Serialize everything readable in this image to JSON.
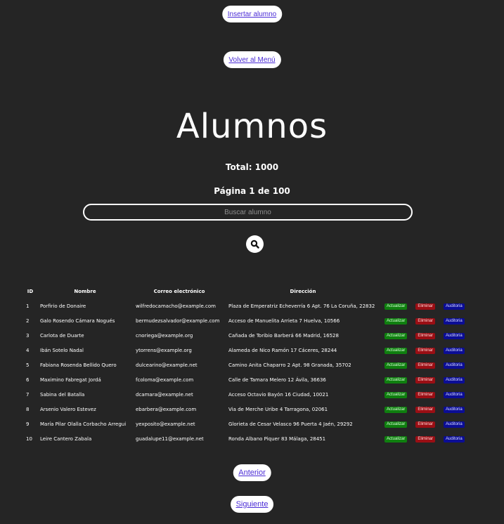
{
  "nav": {
    "insert_label": "Insertar alumno",
    "menu_label": "Volver al Menú"
  },
  "header": {
    "title": "Alumnos",
    "total": "Total: 1000",
    "page": "Página 1 de 100"
  },
  "search": {
    "placeholder": "Buscar alumno",
    "icon": "search-icon"
  },
  "table": {
    "headers": [
      "ID",
      "Nombre",
      "Correo electrónico",
      "Dirección"
    ],
    "actions": {
      "update": "Actualizar",
      "delete": "Eliminar",
      "audit": "Auditoria"
    },
    "rows": [
      {
        "id": "1",
        "nombre": "Porfirio de Donaire",
        "correo": "wilfredocamacho@example.com",
        "direccion": "Plaza de Emperatriz Echeverría 6 Apt. 76 La Coruña, 22832"
      },
      {
        "id": "2",
        "nombre": "Galo Rosendo Cámara Nogués",
        "correo": "bermudezsalvador@example.com",
        "direccion": "Acceso de Manuelita Arrieta 7 Huelva, 10566"
      },
      {
        "id": "3",
        "nombre": "Carlota de Duarte",
        "correo": "cnoriega@example.org",
        "direccion": "Cañada de Toribio Barberá 66 Madrid, 16528"
      },
      {
        "id": "4",
        "nombre": "Ibán Sotelo Nadal",
        "correo": "ytorrens@example.org",
        "direccion": "Alameda de Nico Ramón 17 Cáceres, 28244"
      },
      {
        "id": "5",
        "nombre": "Fabiana Rosenda Bellido Quero",
        "correo": "dulcearino@example.net",
        "direccion": "Camino Anita Chaparro 2 Apt. 98 Granada, 35702"
      },
      {
        "id": "6",
        "nombre": "Maximino Fabregat Jordá",
        "correo": "fcoloma@example.com",
        "direccion": "Calle de Tamara Melero 12 Ávila, 36636"
      },
      {
        "id": "7",
        "nombre": "Sabina del Batalla",
        "correo": "dcamara@example.net",
        "direccion": "Acceso Octavio Bayón 16 Ciudad, 10021"
      },
      {
        "id": "8",
        "nombre": "Arsenio Valero Estevez",
        "correo": "ebarbera@example.com",
        "direccion": "Via de Merche Uribe 4 Tarragona, 02061"
      },
      {
        "id": "9",
        "nombre": "María Pilar Olalla Corbacho Arregui",
        "correo": "yexposito@example.net",
        "direccion": "Glorieta de Cesar Velasco 96 Puerta 4 Jaén, 29292"
      },
      {
        "id": "10",
        "nombre": "Leire Cantero Zabala",
        "correo": "guadalupe11@example.net",
        "direccion": "Ronda Albano Piquer 83 Málaga, 28451"
      }
    ]
  },
  "pagination": {
    "prev_label": "Anterior",
    "next_label": "Siguiente"
  }
}
